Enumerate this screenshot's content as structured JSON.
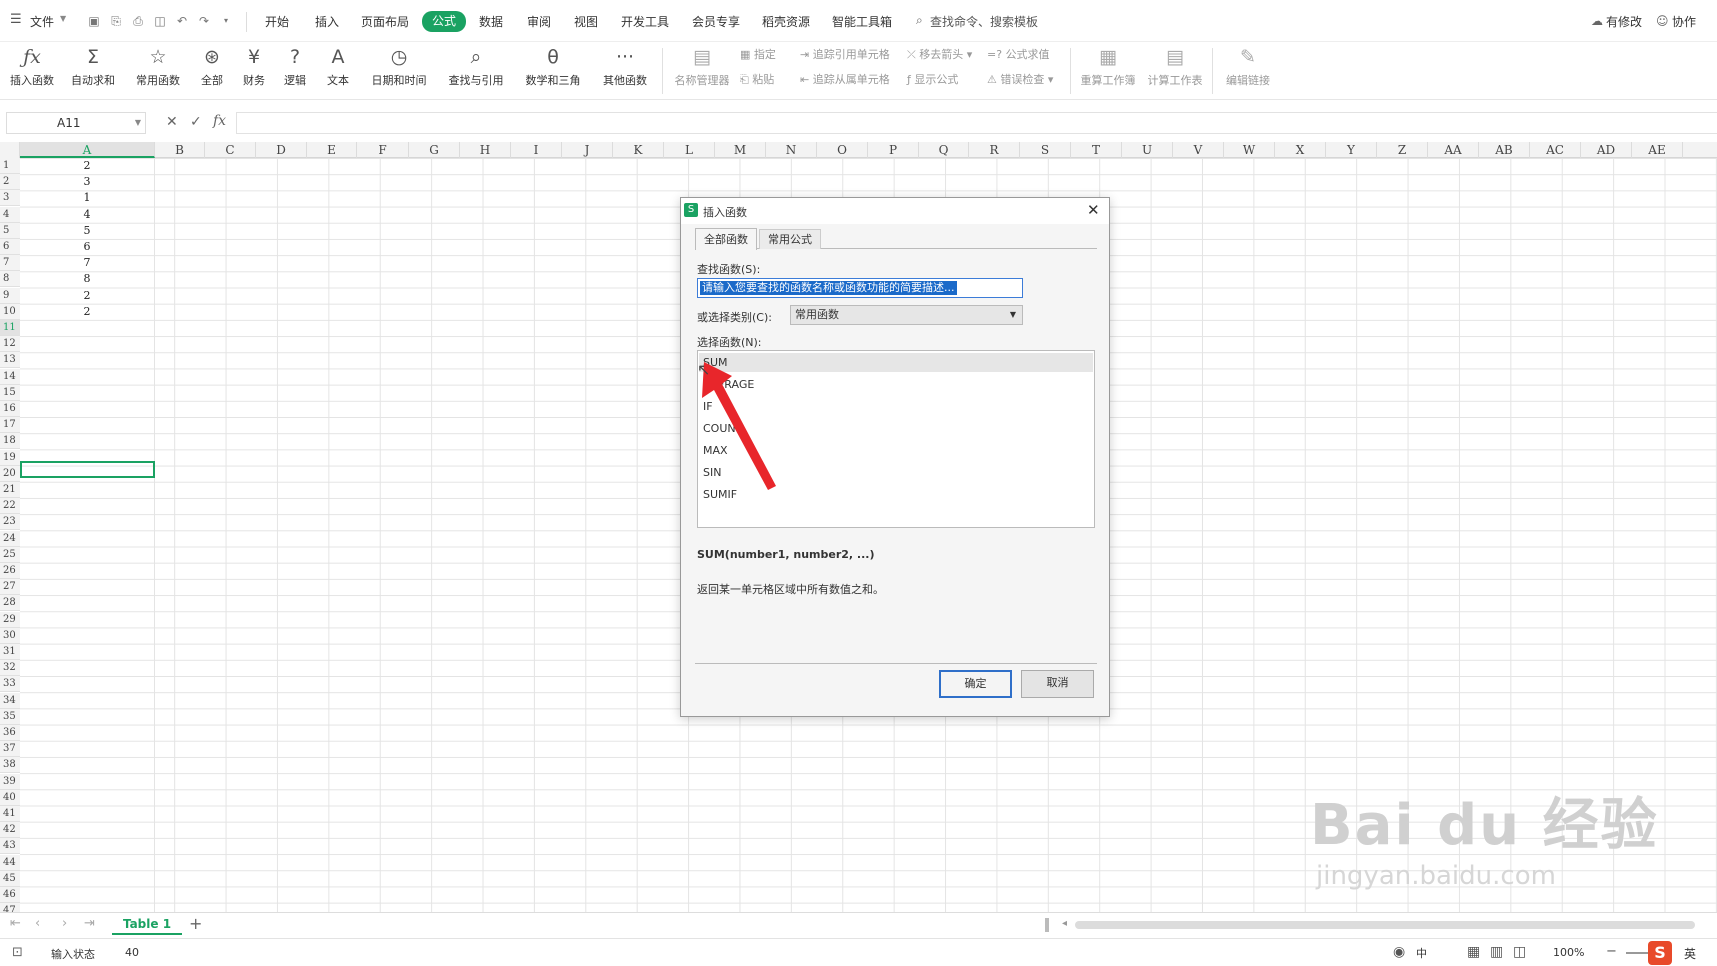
{
  "menubar": {
    "file_label": "文件",
    "tabs": [
      "开始",
      "插入",
      "页面布局",
      "公式",
      "数据",
      "审阅",
      "视图",
      "开发工具",
      "会员专享",
      "稻壳资源",
      "智能工具箱"
    ],
    "search_label": "查找命令、搜索模板",
    "right_modified": "有修改",
    "right_collab": "协作"
  },
  "ribbon": {
    "insert_function": "插入函数",
    "autosum": "自动求和",
    "common": "常用函数",
    "all": "全部",
    "finance": "财务",
    "logic": "逻辑",
    "text": "文本",
    "datetime": "日期和时间",
    "lookup": "查找与引用",
    "math": "数学和三角",
    "other": "其他函数",
    "name_manager": "名称管理器",
    "specify": "指定",
    "paste": "粘贴",
    "trace_precedents": "追踪引用单元格",
    "trace_dependents": "追踪从属单元格",
    "remove_arrows": "移去箭头",
    "show_formulas": "显示公式",
    "eval_formula": "公式求值",
    "error_check": "错误检查",
    "recalc_workbook": "重算工作簿",
    "calc_sheet": "计算工作表",
    "edit_links": "编辑链接"
  },
  "formula_bar": {
    "name_box": "A11",
    "fx": "fx"
  },
  "columns": [
    "A",
    "B",
    "C",
    "D",
    "E",
    "F",
    "G",
    "H",
    "I",
    "J",
    "K",
    "L",
    "M",
    "N",
    "O",
    "P",
    "Q",
    "R",
    "S",
    "T",
    "U",
    "V",
    "W",
    "X",
    "Y",
    "Z",
    "AA",
    "AB",
    "AC",
    "AD",
    "AE"
  ],
  "rows": [
    "1",
    "2",
    "3",
    "4",
    "5",
    "6",
    "7",
    "8",
    "9",
    "10",
    "11",
    "12",
    "13",
    "14",
    "15",
    "16",
    "17",
    "18",
    "19",
    "20",
    "21",
    "22",
    "23",
    "24",
    "25",
    "26",
    "27",
    "28",
    "29",
    "30",
    "31",
    "32",
    "33",
    "34",
    "35",
    "36",
    "37",
    "38",
    "39",
    "40",
    "41",
    "42",
    "43",
    "44",
    "45",
    "46",
    "47"
  ],
  "cell_values": [
    "2",
    "3",
    "1",
    "4",
    "5",
    "6",
    "7",
    "8",
    "2",
    "2"
  ],
  "dialog": {
    "title": "插入函数",
    "tab_all": "全部函数",
    "tab_common": "常用公式",
    "search_label": "查找函数(S):",
    "search_placeholder": "请输入您要查找的函数名称或函数功能的简要描述...",
    "category_label": "或选择类别(C):",
    "category_value": "常用函数",
    "select_label": "选择函数(N):",
    "functions": [
      "SUM",
      "AVERAGE",
      "IF",
      "COUNT",
      "MAX",
      "SIN",
      "SUMIF"
    ],
    "signature": "SUM(number1, number2, ...)",
    "description": "返回某一单元格区域中所有数值之和。",
    "ok": "确定",
    "cancel": "取消"
  },
  "sheets": {
    "active": "Table 1"
  },
  "status": {
    "mode": "输入状态",
    "value": "40",
    "zoom": "100%",
    "ime": "中",
    "lang": "英"
  },
  "watermark": {
    "brand": "Bai du 经验",
    "url": "jingyan.baidu.com"
  },
  "colors": {
    "accent": "#1aa262",
    "selection": "#1b6ac9",
    "arrow": "#e8262b"
  }
}
